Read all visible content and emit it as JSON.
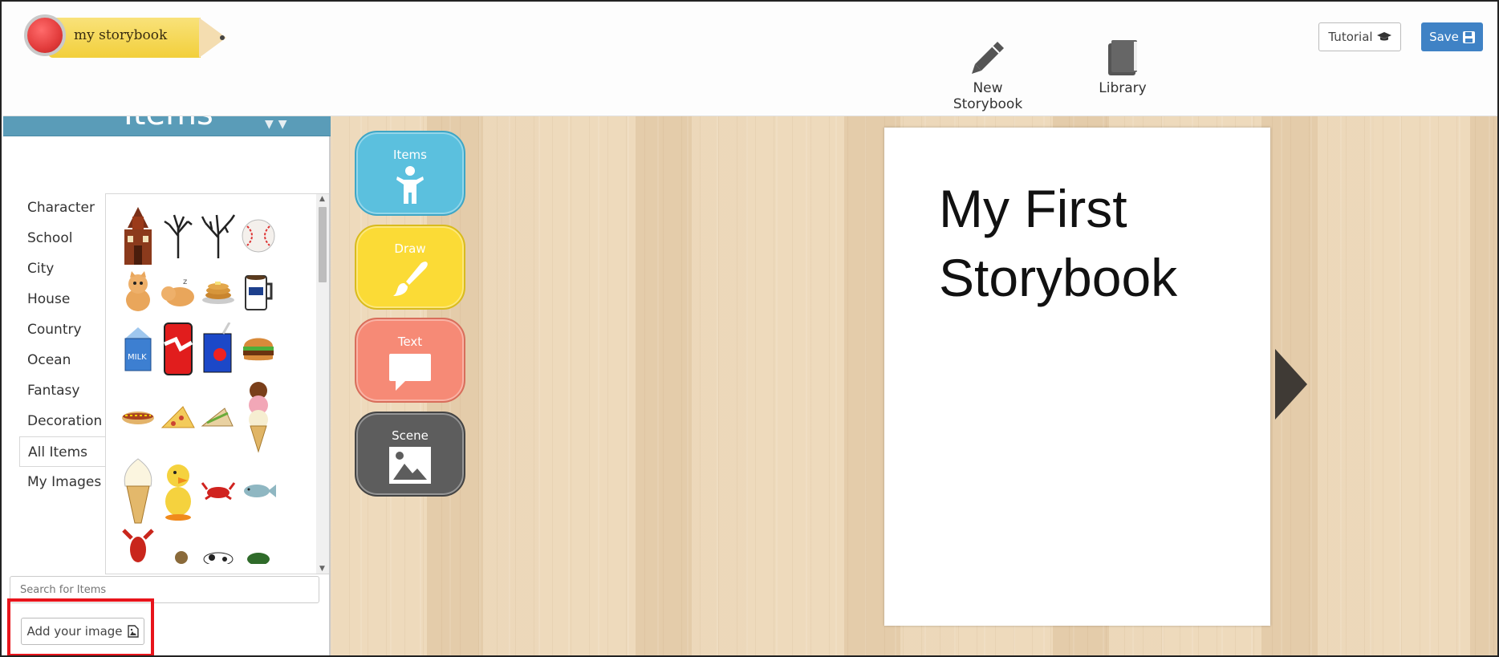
{
  "header": {
    "logo_text": "my storybook",
    "nav": [
      {
        "label": "New Storybook",
        "icon": "pencil-icon"
      },
      {
        "label": "Library",
        "icon": "book-icon"
      }
    ],
    "tutorial_label": "Tutorial",
    "save_label": "Save"
  },
  "sidebar": {
    "title": "Items",
    "categories": [
      "Character",
      "School",
      "City",
      "House",
      "Country",
      "Ocean",
      "Fantasy",
      "Decoration",
      "All Items",
      "My Images"
    ],
    "active_category": "All Items",
    "items": [
      "schoolhouse",
      "bare-tree",
      "bare-tree-2",
      "baseball",
      "cat",
      "sleeping-cat",
      "pancakes",
      "coffee-mug",
      "milk-carton",
      "soda-can",
      "juice-box",
      "hamburger",
      "hot-dog",
      "pizza-slice",
      "sandwich",
      "ice-cream-triple",
      "ice-cream-cone",
      "duck",
      "crab",
      "fish",
      "lobster",
      "snail",
      "cow",
      "turtle"
    ],
    "search_placeholder": "Search for Items",
    "add_image_label": "Add your image"
  },
  "tools": [
    {
      "label": "Items",
      "icon": "person-icon",
      "color": "#5bc0de"
    },
    {
      "label": "Draw",
      "icon": "paintbrush-icon",
      "color": "#fbdb36"
    },
    {
      "label": "Text",
      "icon": "speech-bubble-icon",
      "color": "#f68a76"
    },
    {
      "label": "Scene",
      "icon": "picture-icon",
      "color": "#5d5d5d"
    }
  ],
  "page": {
    "title": "My First Storybook"
  },
  "colors": {
    "save": "#3f82c5",
    "sidebar_header": "#5a9cb8",
    "highlight": "#e8141b",
    "wood": "#e8d1b0"
  }
}
